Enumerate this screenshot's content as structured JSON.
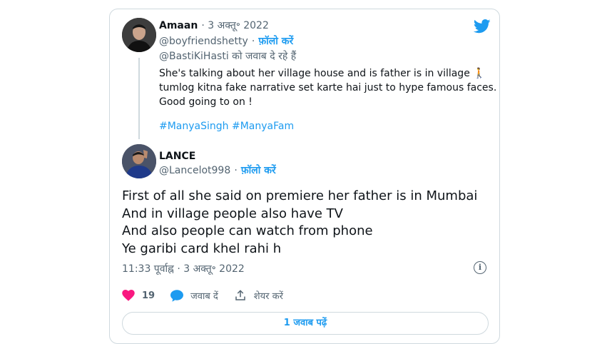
{
  "parent_tweet": {
    "author_name": "Amaan",
    "date": "· 3 अक्तू॰ 2022",
    "handle": "@boyfriendshetty",
    "follow_sep": "·",
    "follow_label": "फ़ॉलो करें",
    "replying_to": "@BastiKiHasti को जवाब दे रहे हैं",
    "lines": [
      "She's talking about her village house and is father is in village 🚶",
      "tumlog kitna fake narrative set karte hai just to hype famous faces.",
      "Good going to on !"
    ],
    "hashtags": "#ManyaSingh #ManyaFam"
  },
  "main_tweet": {
    "author_name": "LANCE",
    "handle": "@Lancelot998",
    "follow_sep": "·",
    "follow_label": "फ़ॉलो करें",
    "lines": [
      "First of all she said on premiere her father is in Mumbai",
      "And in village people also have TV",
      "And also people can watch from phone",
      "Ye garibi card khel rahi h"
    ],
    "timestamp": "11:33 पूर्वाह्न · 3 अक्तू॰ 2022",
    "info_glyph": "i"
  },
  "actions": {
    "like_count": "19",
    "reply_label": "जवाब दें",
    "share_label": "शेयर करें"
  },
  "read_replies_label": "1 जवाब पढ़ें",
  "colors": {
    "accent": "#1d9bf0",
    "like": "#f91880",
    "muted": "#536471",
    "border": "#cfd9de"
  },
  "icons": [
    "twitter-logo-icon",
    "heart-icon",
    "reply-bubble-icon",
    "share-icon",
    "info-icon"
  ]
}
